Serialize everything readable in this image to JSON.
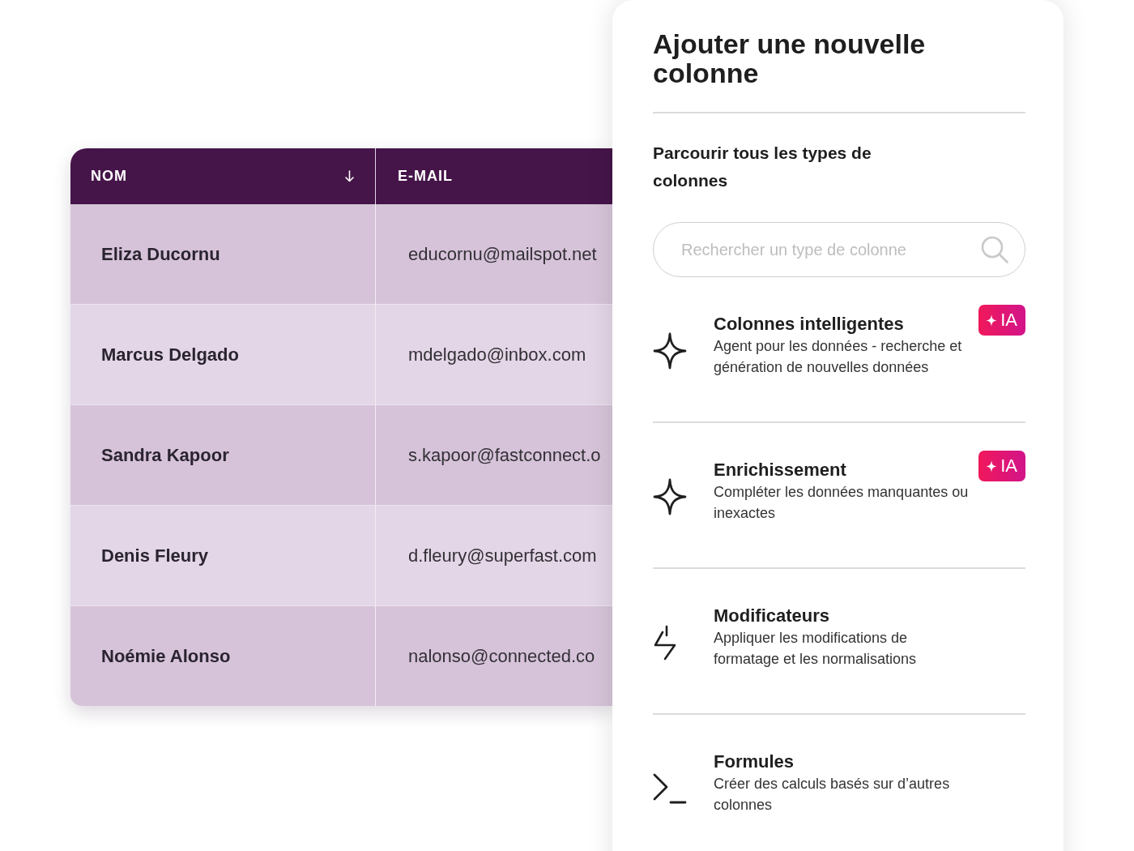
{
  "table": {
    "columns": [
      {
        "label": "NOM",
        "sorted": true
      },
      {
        "label": "E-MAIL",
        "sorted": false
      }
    ],
    "rows": [
      {
        "name": "Eliza Ducornu",
        "email": "educornu@mailspot.net"
      },
      {
        "name": "Marcus Delgado",
        "email": "mdelgado@inbox.com"
      },
      {
        "name": "Sandra Kapoor",
        "email": "s.kapoor@fastconnect.o"
      },
      {
        "name": "Denis Fleury",
        "email": "d.fleury@superfast.com"
      },
      {
        "name": "Noémie Alonso",
        "email": "nalonso@connected.co"
      }
    ]
  },
  "panel": {
    "title": "Ajouter une nouvelle colonne",
    "subtitle": "Parcourir tous les types de colonnes",
    "search": {
      "placeholder": "Rechercher un type de colonne"
    },
    "column_types": [
      {
        "kind": "ai",
        "title": "Colonnes intelligentes",
        "description": "Agent pour les données - recherche et génération de nouvelles données",
        "badge": "IA"
      },
      {
        "kind": "ai",
        "title": "Enrichissement",
        "description": "Compléter les données manquantes ou inexactes",
        "badge": "IA"
      },
      {
        "kind": "modifier",
        "title": "Modificateurs",
        "description": "Appliquer les modifications de formatage et les normalisations"
      },
      {
        "kind": "formula",
        "title": "Formules",
        "description": "Créer des calculs basés sur d’autres colonnes"
      }
    ]
  }
}
